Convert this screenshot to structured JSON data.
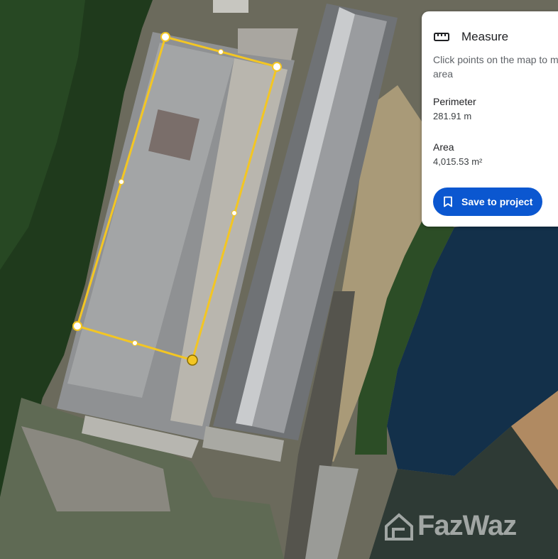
{
  "panel": {
    "title": "Measure",
    "title_icon": "ruler-icon",
    "instruction": "Click points on the map to m area",
    "instruction_line1": "Click points on the map to m",
    "instruction_line2": "area",
    "perimeter_label": "Perimeter",
    "perimeter_value": "281.91 m",
    "area_label": "Area",
    "area_value": "4,015.53 m²",
    "save_button_label": "Save to project",
    "save_icon": "bookmark-icon"
  },
  "watermark": {
    "text": "FazWaz",
    "icon": "house-logo-icon"
  },
  "colors": {
    "measure_line": "#f3c623",
    "button_bg": "#0b57d0",
    "water": "#14304a",
    "forest": "#23401f"
  }
}
